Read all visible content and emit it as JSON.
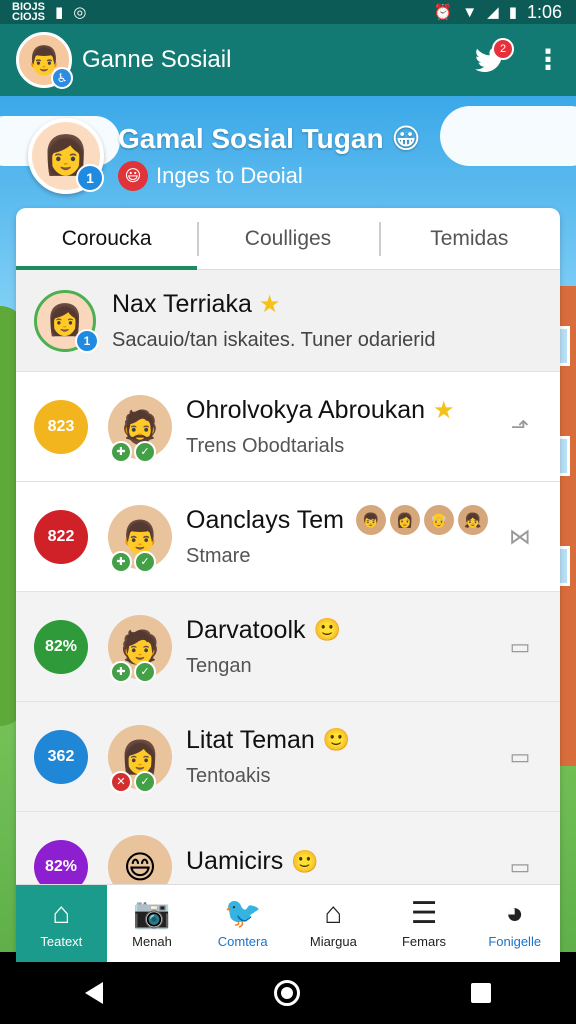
{
  "status_bar": {
    "carrier": "BIOJS\nCIOJS",
    "time": "1:06"
  },
  "app_bar": {
    "title": "Ganne Sosiail",
    "notification_count": "2"
  },
  "hero": {
    "title": "Gamal Sosial Tugan",
    "subtitle": "Inges to Deoial",
    "avatar_count": "1"
  },
  "tabs": [
    {
      "label": "Coroucka",
      "active": true
    },
    {
      "label": "Coulliges",
      "active": false
    },
    {
      "label": "Temidas",
      "active": false
    }
  ],
  "me": {
    "name": "Nax Terriaka",
    "status": "Sacauio/tan iskaites. Tuner odarierid",
    "count": "1"
  },
  "contacts": [
    {
      "score": "823",
      "color": "#f3b51e",
      "name": "Ohrolvokya Abroukan",
      "status": "Trens Obodtarials",
      "emoji": "star"
    },
    {
      "score": "822",
      "color": "#cf2127",
      "name": "Oanclays Tem",
      "status": "Stmare",
      "emoji": "group"
    },
    {
      "score": "82%",
      "color": "#2e9a3a",
      "name": "Darvatoolk",
      "status": "Tengan",
      "emoji": "smile"
    },
    {
      "score": "362",
      "color": "#1f87d6",
      "name": "Litat Teman",
      "status": "Tentoakis",
      "emoji": "smile"
    },
    {
      "score": "82%",
      "color": "#8e1fd0",
      "name": "Uamicirs",
      "status": "",
      "emoji": "smile"
    }
  ],
  "bottom_nav": [
    {
      "label": "Teatext",
      "icon": "home-icon"
    },
    {
      "label": "Menah",
      "icon": "camera-icon"
    },
    {
      "label": "Comtera",
      "icon": "bird-icon"
    },
    {
      "label": "Miargua",
      "icon": "house-outline-icon"
    },
    {
      "label": "Femars",
      "icon": "list-icon"
    },
    {
      "label": "Fonigelle",
      "icon": "color-wheel-icon"
    }
  ]
}
